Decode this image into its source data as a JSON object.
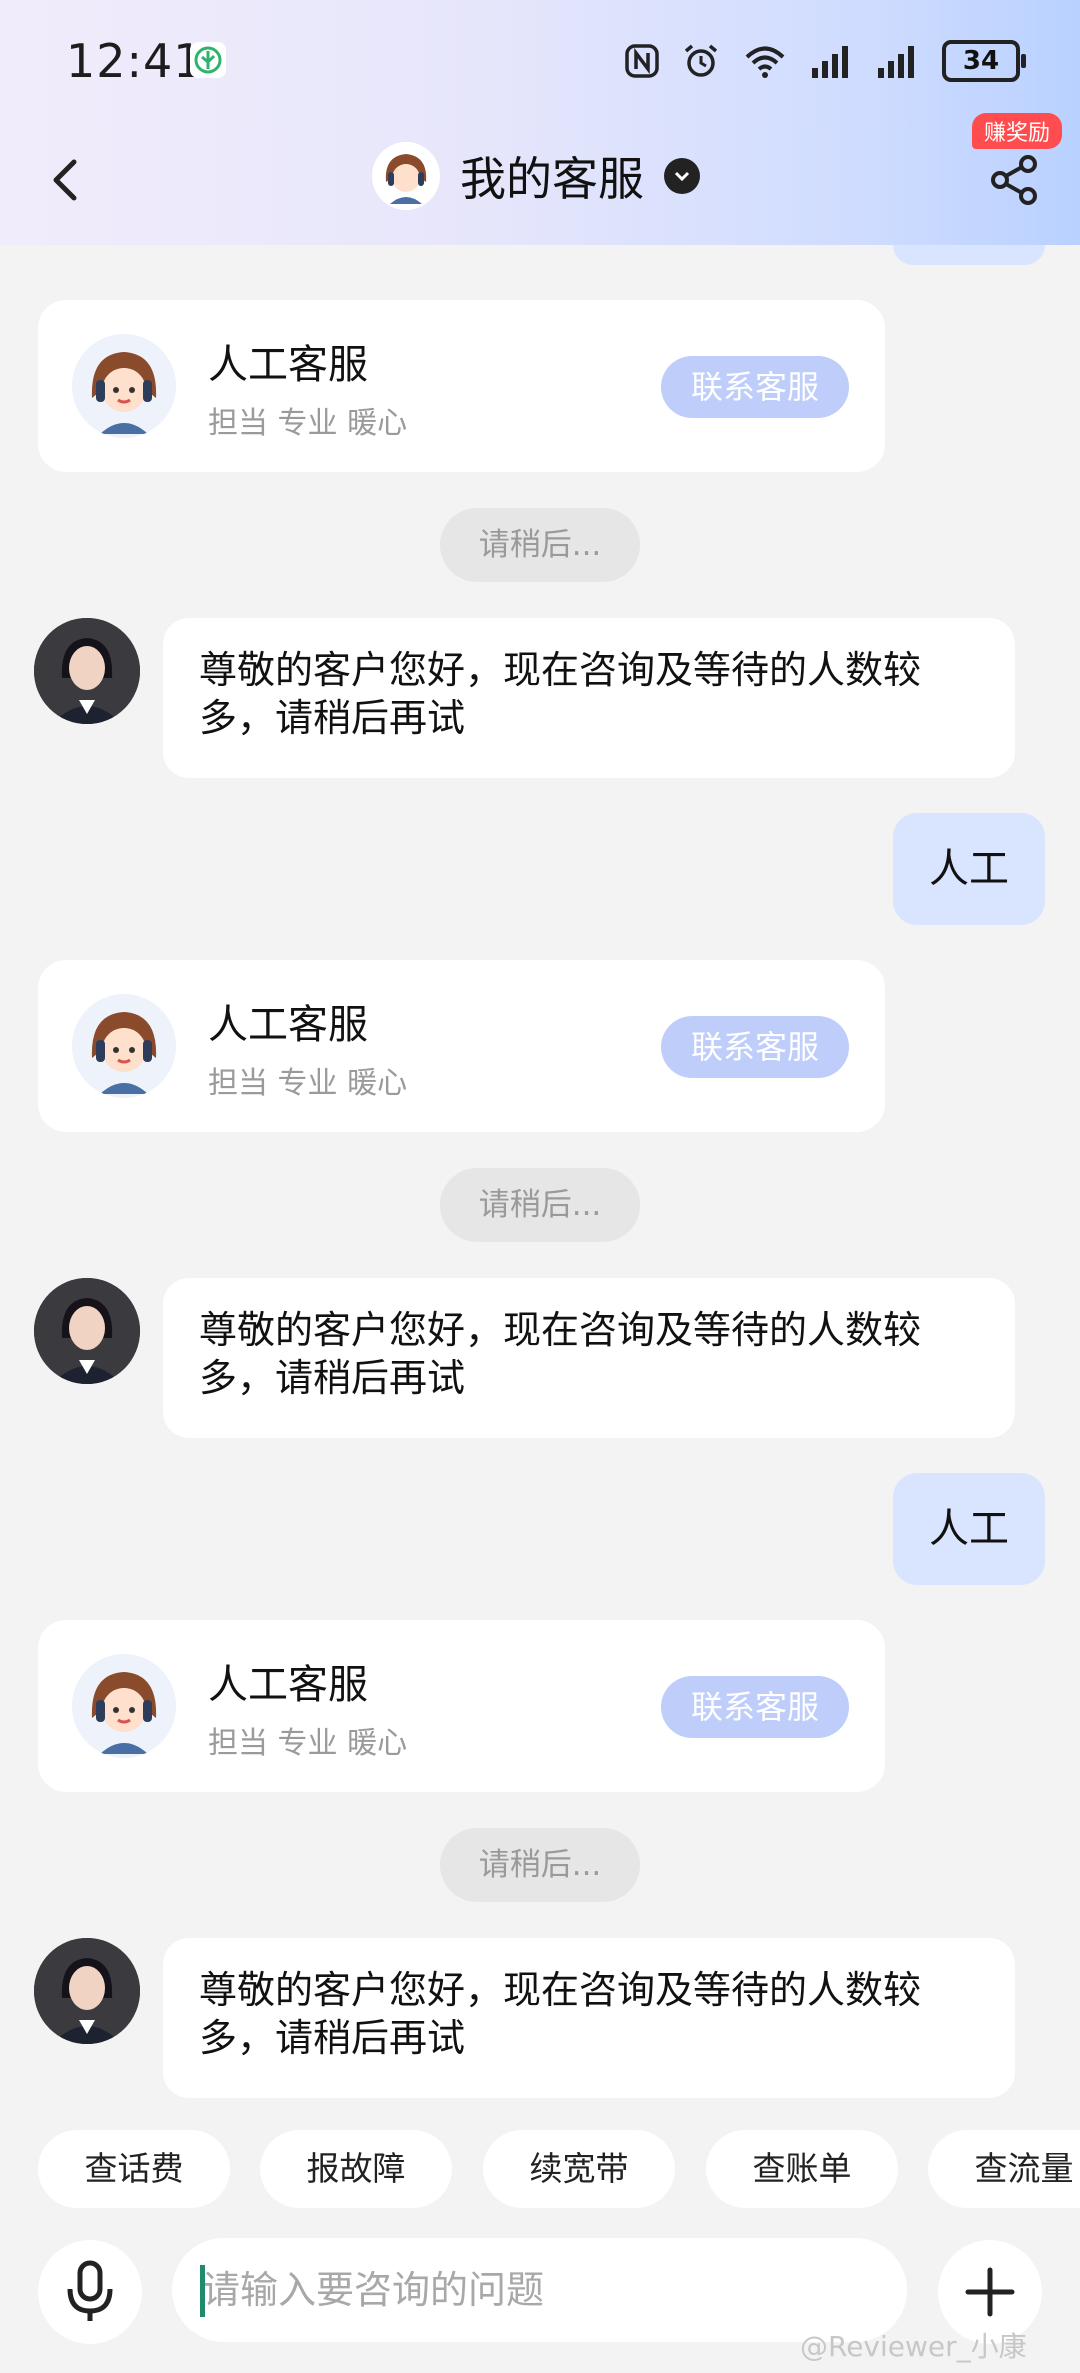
{
  "status_bar": {
    "time": "12:41",
    "battery": "34",
    "icons": [
      "leaf-app-icon",
      "nfc-icon",
      "alarm-icon",
      "wifi-6-icon",
      "signal-icon",
      "signal-icon-2",
      "battery-icon"
    ]
  },
  "header": {
    "title": "我的客服",
    "reward_badge": "赚奖励",
    "icons": [
      "back-arrow-icon",
      "verified-check-icon",
      "share-icon"
    ]
  },
  "cards": [
    {
      "title": "人工客服",
      "subtitle": "担当 专业 暖心",
      "button": "联系客服"
    },
    {
      "title": "人工客服",
      "subtitle": "担当 专业 暖心",
      "button": "联系客服"
    },
    {
      "title": "人工客服",
      "subtitle": "担当 专业 暖心",
      "button": "联系客服"
    }
  ],
  "wait_notices": [
    "请稍后...",
    "请稍后...",
    "请稍后..."
  ],
  "agent_messages": [
    {
      "line1": "尊敬的客户您好，现在咨询及等待的人数较",
      "line2": "多，请稍后再试"
    },
    {
      "line1": "尊敬的客户您好，现在咨询及等待的人数较",
      "line2": "多，请稍后再试"
    },
    {
      "line1": "尊敬的客户您好，现在咨询及等待的人数较",
      "line2": "多，请稍后再试"
    }
  ],
  "user_messages": [
    "人工",
    "人工"
  ],
  "quick_replies": [
    "查话费",
    "报故障",
    "续宽带",
    "查账单",
    "查流量"
  ],
  "input": {
    "placeholder": "请输入要咨询的问题",
    "value": ""
  },
  "watermark": "@Reviewer_小康",
  "colors": {
    "accent": "#bfcdfb",
    "user_bubble": "#d9e5ff",
    "reward": "#ff4d4f"
  }
}
